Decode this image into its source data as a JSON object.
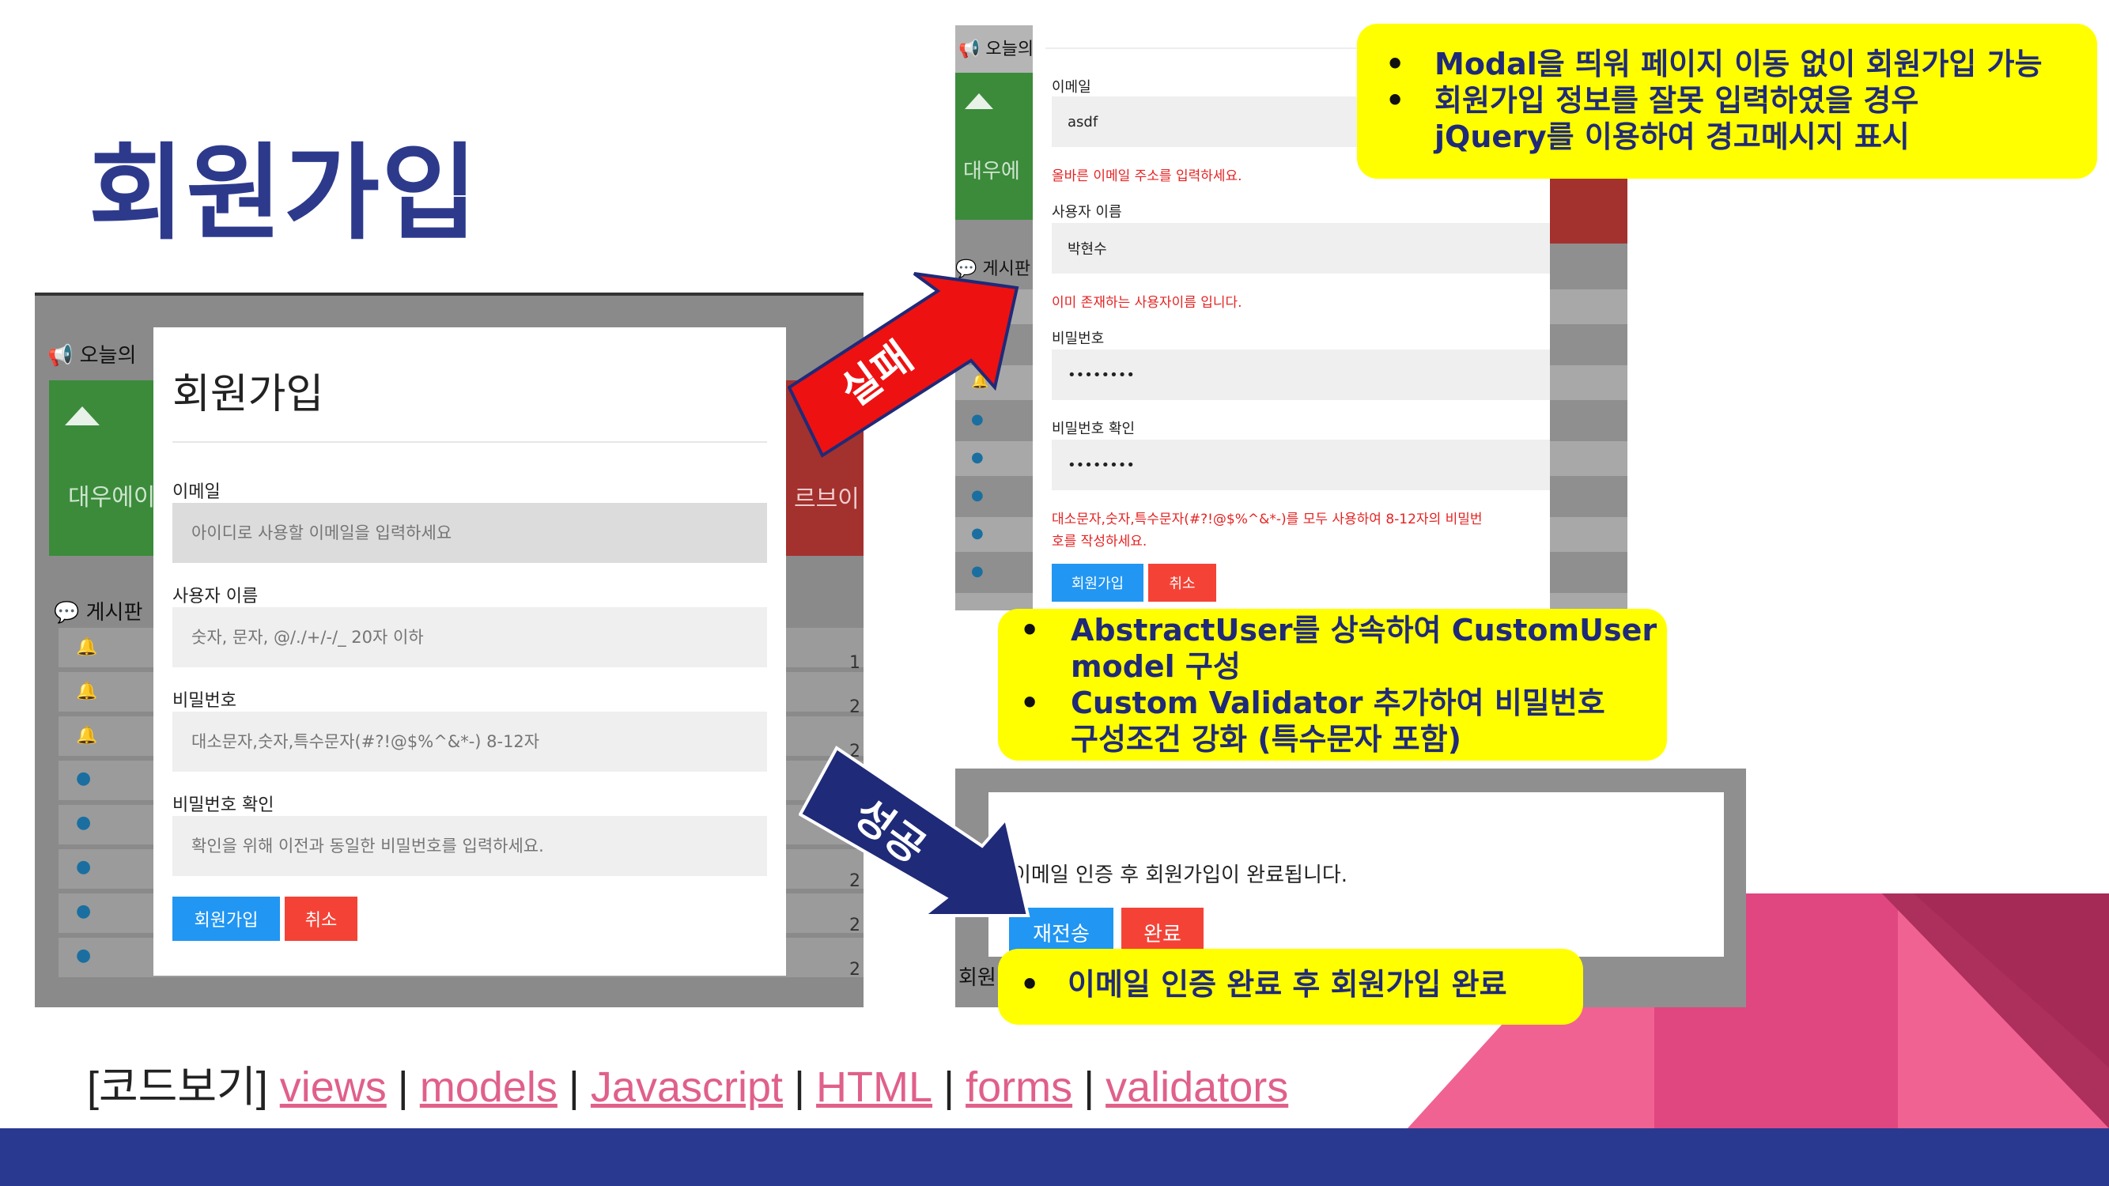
{
  "slide": {
    "title": "회원가입",
    "code_links": {
      "prefix": "[코드보기]",
      "links": [
        "views",
        "models",
        "Javascript",
        "HTML",
        "forms",
        "validators"
      ],
      "separator": "|"
    },
    "colors": {
      "title": "#2d3a8c",
      "band": "#2a3990",
      "link": "#e0608a",
      "callout": "#ffff00",
      "arrow_fail": "#ee1111",
      "arrow_ok": "#1f2a78"
    }
  },
  "arrows": {
    "fail_label": "실패",
    "success_label": "성공"
  },
  "left_screenshot": {
    "background": {
      "today_label": "오늘의",
      "green_panel_text": "대우에이",
      "red_panel_text": "르브이",
      "board_label": "게시판",
      "row_numbers": [
        "1",
        "2",
        "2",
        "2",
        "2",
        "2"
      ],
      "row_icons": [
        "bell-icon",
        "bell-icon",
        "bell-icon",
        "comment-icon",
        "comment-icon",
        "comment-icon",
        "comment-icon",
        "comment-icon"
      ]
    },
    "modal": {
      "title": "회원가입",
      "fields": [
        {
          "label": "이메일",
          "placeholder": "아이디로 사용할 이메일을 입력하세요"
        },
        {
          "label": "사용자 이름",
          "placeholder": "숫자, 문자, @/./+/-/_ 20자 이하"
        },
        {
          "label": "비밀번호",
          "placeholder": "대소문자,숫자,특수문자(#?!@$%^&*-) 8-12자"
        },
        {
          "label": "비밀번호 확인",
          "placeholder": "확인을 위해 이전과 동일한 비밀번호를 입력하세요."
        }
      ],
      "submit_label": "회원가입",
      "cancel_label": "취소"
    }
  },
  "right_top_screenshot": {
    "background": {
      "today_label": "오늘의",
      "green_panel_text": "대우에",
      "board_label": "게시판"
    },
    "form": {
      "email_label": "이메일",
      "email_value": "asdf",
      "email_error": "올바른 이메일 주소를 입력하세요.",
      "username_label": "사용자 이름",
      "username_value": "박현수",
      "username_error": "이미 존재하는 사용자이름 입니다.",
      "password_label": "비밀번호",
      "password_value": "••••••••",
      "password_confirm_label": "비밀번호 확인",
      "password_confirm_value": "••••••••",
      "password_error_line1": "대소문자,숫자,특수문자(#?!@$%^&*-)를 모두 사용하여 8-12자의 비밀번",
      "password_error_line2": "호를 작성하세요.",
      "submit_label": "회원가입",
      "cancel_label": "취소"
    }
  },
  "right_bottom_screenshot": {
    "message": "이메일 인증 후 회원가입이 완료됩니다.",
    "resend_label": "재전송",
    "done_label": "완료",
    "side_label": "회원"
  },
  "callouts": [
    {
      "bullets": [
        "Modal을 띄워 페이지 이동 없이 회원가입 가능",
        "회원가입 정보를 잘못 입력하였을 경우",
        "jQuery를 이용하여 경고메시지 표시"
      ],
      "bullet_flags": [
        true,
        true,
        false
      ]
    },
    {
      "bullets": [
        "AbstractUser를 상속하여 CustomUser",
        "model 구성",
        "Custom Validator 추가하여 비밀번호",
        "구성조건 강화 (특수문자 포함)"
      ],
      "bullet_flags": [
        true,
        false,
        true,
        false
      ]
    },
    {
      "bullets": [
        "이메일 인증 완료 후 회원가입 완료"
      ],
      "bullet_flags": [
        true
      ]
    }
  ]
}
